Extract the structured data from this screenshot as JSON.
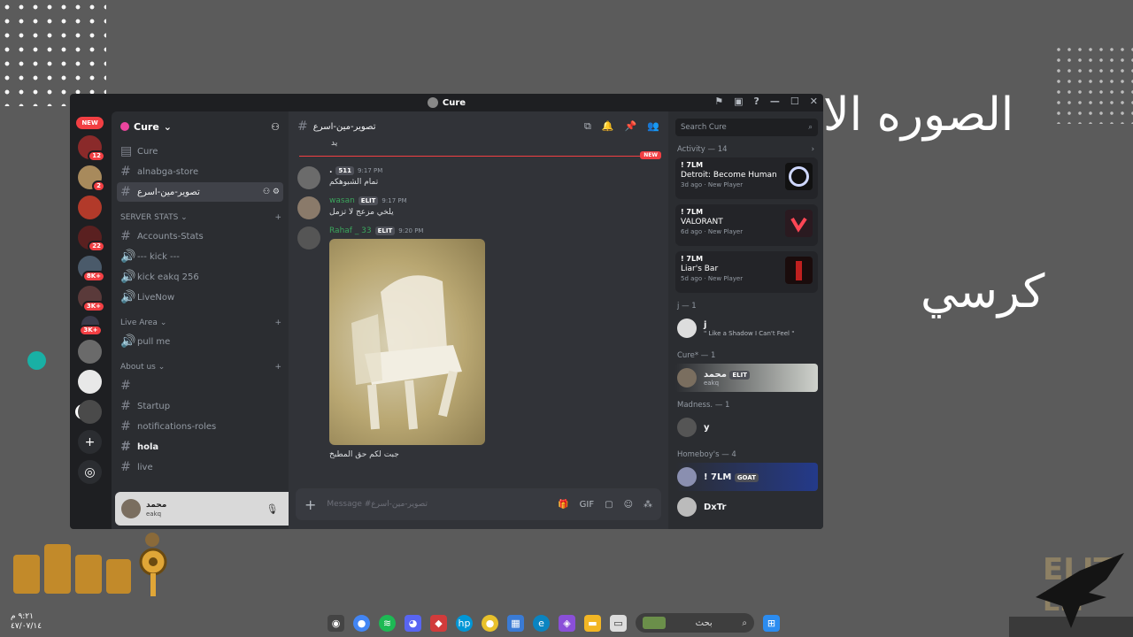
{
  "background": {
    "text_top_right": "الصوره الا",
    "text_mid_right": "كرسي",
    "clock_time": "٩:٢١ م",
    "clock_date": "٤٧/٠٧/١٤"
  },
  "window": {
    "title": "Cure",
    "controls": [
      "—",
      "☐",
      "✕"
    ]
  },
  "rail": {
    "new_label": "NEW",
    "badges": [
      "12",
      "2",
      "22",
      "8K+",
      "3K+",
      "3K+"
    ],
    "add_label": "+",
    "discover_label": "◎"
  },
  "sidebar": {
    "server_name": "Cure",
    "channels_top": [
      {
        "label": "Cure"
      },
      {
        "label": "alnabga-store"
      },
      {
        "label": "تصوير-مين-اسرع"
      }
    ],
    "cat_server_stats": "SERVER STATS",
    "server_stats": [
      {
        "label": "Accounts-Stats"
      },
      {
        "label": "--- kick ---"
      },
      {
        "label": "kick eakq 256"
      },
      {
        "label": "LiveNow"
      }
    ],
    "cat_live_area": "Live Area",
    "live_area": [
      {
        "label": "pull me"
      }
    ],
    "cat_about_us": "About us",
    "about_us": [
      {
        "label": ""
      },
      {
        "label": "Startup"
      },
      {
        "label": "notifications-roles"
      },
      {
        "label": "hola"
      },
      {
        "label": "live"
      }
    ]
  },
  "user_panel": {
    "name": "محمد",
    "sub": "eakq"
  },
  "chat": {
    "channel_name": "تصوير-مين-اسرع",
    "new_label": "NEW",
    "top_fragment": "يد",
    "messages": [
      {
        "name": ".",
        "tag": "511",
        "time": "9:17 PM",
        "text": "تمام الشبوهكم"
      },
      {
        "name": "wasan",
        "tag": "ELIT",
        "time": "9:17 PM",
        "text": "يلخي مزعج لا تزمل"
      },
      {
        "name": "Rahaf _ 33",
        "tag": "ELIT",
        "time": "9:20 PM",
        "text": "جبت لكم حق المطبخ"
      }
    ],
    "composer_placeholder": "Message #تصوير-مين-اسرع"
  },
  "members": {
    "search_placeholder": "Search Cure",
    "activity_header": "Activity — 14",
    "activities": [
      {
        "user": "! 7LM",
        "game": "Detroit: Become Human",
        "meta": "3d ago",
        "tag": "New Player"
      },
      {
        "user": "! 7LM",
        "game": "VALORANT",
        "meta": "6d ago",
        "tag": "New Player"
      },
      {
        "user": "! 7LM",
        "game": "Liar's Bar",
        "meta": "5d ago",
        "tag": "New Player"
      }
    ],
    "groups": [
      {
        "header": "j — 1",
        "members": [
          {
            "name": "j",
            "sub": "\" Like a Shadow I Can't Feel \""
          }
        ]
      },
      {
        "header": "Cure* — 1",
        "members": [
          {
            "name": "محمد",
            "tag": "ELIT",
            "sub": "eakq"
          }
        ]
      },
      {
        "header": "Madness. — 1",
        "members": [
          {
            "name": "y",
            "sub": ""
          }
        ]
      },
      {
        "header": "Homeboy's — 4",
        "members": [
          {
            "name": "! 7LM",
            "tag": "GOAT",
            "sub": ""
          },
          {
            "name": "DxTr",
            "sub": ""
          }
        ]
      }
    ]
  },
  "taskbar": {
    "search_placeholder": "بحث"
  }
}
